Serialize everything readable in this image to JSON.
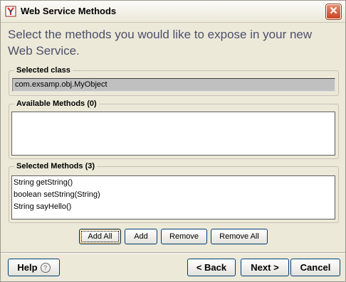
{
  "window": {
    "title": "Web Service Methods",
    "close_label": "✕"
  },
  "instruction": "Select the methods you would like to expose in your new Web Service.",
  "selected_class": {
    "label": "Selected class",
    "value": "com.exsamp.obj.MyObject"
  },
  "available_methods": {
    "label": "Available Methods (0)",
    "items": []
  },
  "selected_methods": {
    "label": "Selected Methods (3)",
    "items": [
      "String getString()",
      "boolean setString(String)",
      "String sayHello()"
    ]
  },
  "actions": {
    "add_all": "Add All",
    "add": "Add",
    "remove": "Remove",
    "remove_all": "Remove All"
  },
  "footer": {
    "help": "Help",
    "help_icon_glyph": "?",
    "back": "< Back",
    "next": "Next >",
    "cancel": "Cancel"
  },
  "colors": {
    "instruction_text": "#4c4f6b",
    "close_button": "#c94522",
    "dialog_bg": "#ece9d8"
  }
}
